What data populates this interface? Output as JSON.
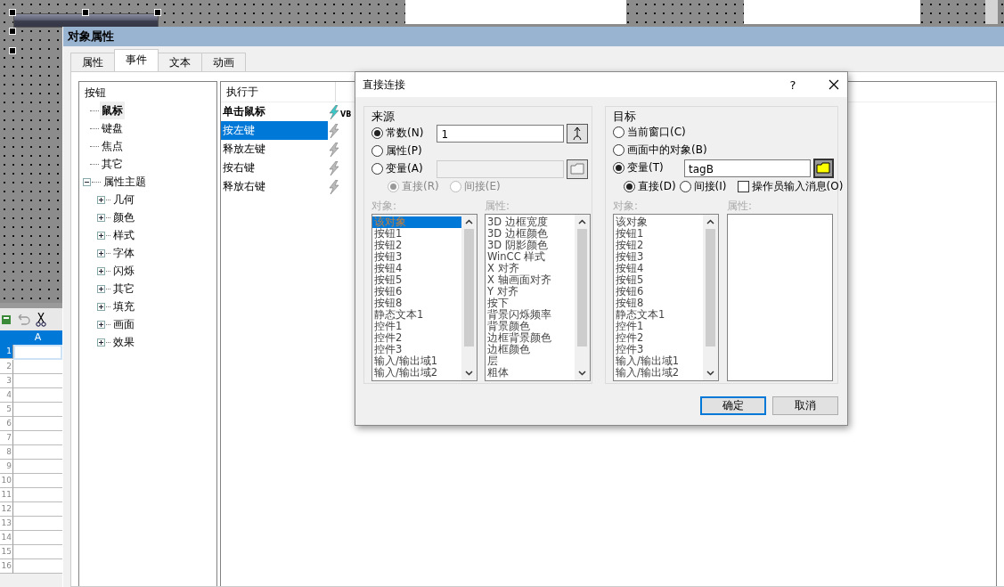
{
  "spreadsheet": {
    "column_header": "A",
    "rows": [
      {
        "label": "1",
        "selected": true
      },
      {
        "label": "2",
        "selected": false
      },
      {
        "label": "3",
        "selected": false
      },
      {
        "label": "4",
        "selected": false
      },
      {
        "label": "5",
        "selected": false
      },
      {
        "label": "6",
        "selected": false
      },
      {
        "label": "7",
        "selected": false
      },
      {
        "label": "8",
        "selected": false
      },
      {
        "label": "9",
        "selected": false
      },
      {
        "label": "10",
        "selected": false
      },
      {
        "label": "11",
        "selected": false
      },
      {
        "label": "12",
        "selected": false
      },
      {
        "label": "13",
        "selected": false
      },
      {
        "label": "14",
        "selected": false
      },
      {
        "label": "15",
        "selected": false
      },
      {
        "label": "16",
        "selected": false
      }
    ]
  },
  "properties_window": {
    "title": "对象属性",
    "tabs": [
      {
        "label": "属性",
        "selected": false
      },
      {
        "label": "事件",
        "selected": true
      },
      {
        "label": "文本",
        "selected": false
      },
      {
        "label": "动画",
        "selected": false
      }
    ],
    "tree": {
      "label": "按钮",
      "children": [
        {
          "label": "鼠标",
          "selected": true
        },
        {
          "label": "键盘",
          "selected": false
        },
        {
          "label": "焦点",
          "selected": false
        },
        {
          "label": "其它",
          "selected": false
        },
        {
          "label": "属性主题",
          "selected": false,
          "expanded": true,
          "children": [
            {
              "label": "几何",
              "selected": false,
              "expanded": false
            },
            {
              "label": "颜色",
              "selected": false,
              "expanded": false
            },
            {
              "label": "样式",
              "selected": false,
              "expanded": false
            },
            {
              "label": "字体",
              "selected": false,
              "expanded": false
            },
            {
              "label": "闪烁",
              "selected": false,
              "expanded": false
            },
            {
              "label": "其它",
              "selected": false,
              "expanded": false
            },
            {
              "label": "填充",
              "selected": false,
              "expanded": false
            },
            {
              "label": "画面",
              "selected": false,
              "expanded": false
            },
            {
              "label": "效果",
              "selected": false,
              "expanded": false
            }
          ]
        }
      ]
    },
    "events": {
      "column_header": "执行于",
      "rows": [
        {
          "label": "单击鼠标",
          "configured": true,
          "selected": false,
          "icon_label": "VB"
        },
        {
          "label": "按左键",
          "configured": false,
          "selected": true
        },
        {
          "label": "释放左键",
          "configured": false,
          "selected": false
        },
        {
          "label": "按右键",
          "configured": false,
          "selected": false
        },
        {
          "label": "释放右键",
          "configured": false,
          "selected": false
        }
      ]
    }
  },
  "dialog": {
    "title": "直接连接",
    "help": "?",
    "source": {
      "label": "来源",
      "options": [
        {
          "label": "常数(N)",
          "selected": true,
          "field": "1",
          "field_enabled": true
        },
        {
          "label": "属性(P)",
          "selected": false
        },
        {
          "label": "变量(A)",
          "selected": false,
          "field_enabled": false
        }
      ],
      "sub_options": [
        {
          "label": "直接(R)",
          "selected": true,
          "disabled": true
        },
        {
          "label": "间接(E)",
          "selected": false,
          "disabled": true
        }
      ],
      "objects_label": "对象:",
      "objects": [
        {
          "label": "该对象",
          "selected": true
        },
        {
          "label": "按钮1",
          "selected": false
        },
        {
          "label": "按钮2",
          "selected": false
        },
        {
          "label": "按钮3",
          "selected": false
        },
        {
          "label": "按钮4",
          "selected": false
        },
        {
          "label": "按钮5",
          "selected": false
        },
        {
          "label": "按钮6",
          "selected": false
        },
        {
          "label": "按钮8",
          "selected": false
        },
        {
          "label": "静态文本1",
          "selected": false
        },
        {
          "label": "控件1",
          "selected": false
        },
        {
          "label": "控件2",
          "selected": false
        },
        {
          "label": "控件3",
          "selected": false
        },
        {
          "label": "输入/输出域1",
          "selected": false
        },
        {
          "label": "输入/输出域2",
          "selected": false
        }
      ],
      "properties_label": "属性:",
      "properties": [
        "3D 边框宽度",
        "3D 边框颜色",
        "3D 阴影颜色",
        "WinCC 样式",
        "X 对齐",
        "X 轴画面对齐",
        "Y 对齐",
        "按下",
        "背景闪烁频率",
        "背景颜色",
        "边框背景颜色",
        "边框颜色",
        "层",
        "粗体"
      ]
    },
    "target": {
      "label": "目标",
      "options": [
        {
          "label": "当前窗口(C)",
          "selected": false
        },
        {
          "label": "画面中的对象(B)",
          "selected": false
        },
        {
          "label": "变量(T)",
          "selected": true,
          "field": "tagB"
        }
      ],
      "sub_options": [
        {
          "label": "直接(D)",
          "selected": true,
          "disabled": false
        },
        {
          "label": "间接(I)",
          "selected": false,
          "disabled": false
        }
      ],
      "operator_message": {
        "label": "操作员输入消息(O)",
        "checked": false
      },
      "objects_label": "对象:",
      "objects": [
        {
          "label": "该对象",
          "selected": false
        },
        {
          "label": "按钮1",
          "selected": false
        },
        {
          "label": "按钮2",
          "selected": false
        },
        {
          "label": "按钮3",
          "selected": false
        },
        {
          "label": "按钮4",
          "selected": false
        },
        {
          "label": "按钮5",
          "selected": false
        },
        {
          "label": "按钮6",
          "selected": false
        },
        {
          "label": "按钮8",
          "selected": false
        },
        {
          "label": "静态文本1",
          "selected": false
        },
        {
          "label": "控件1",
          "selected": false
        },
        {
          "label": "控件2",
          "selected": false
        },
        {
          "label": "控件3",
          "selected": false
        },
        {
          "label": "输入/输出域1",
          "selected": false
        },
        {
          "label": "输入/输出域2",
          "selected": false
        }
      ],
      "properties_label": "属性:"
    },
    "buttons": [
      {
        "label": "确定",
        "default": true
      },
      {
        "label": "取消",
        "default": false
      }
    ]
  }
}
